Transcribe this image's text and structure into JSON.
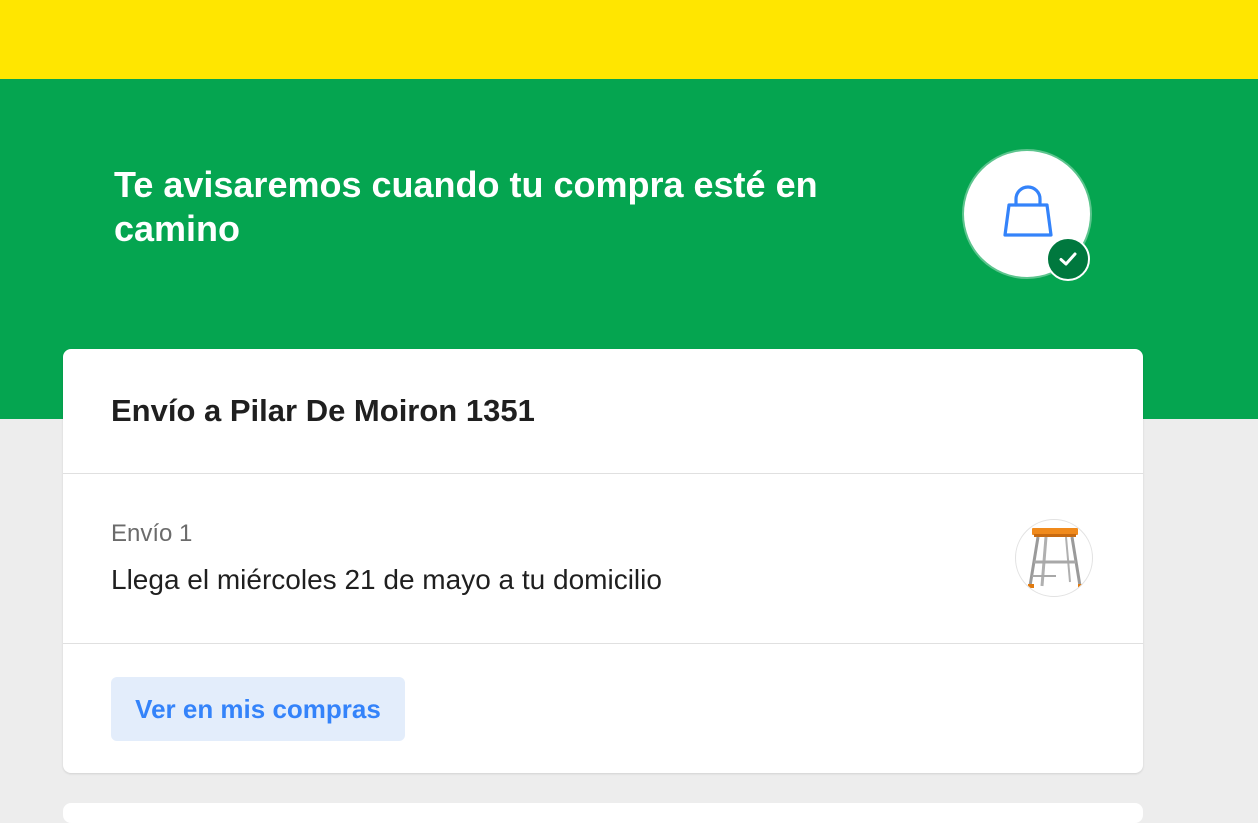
{
  "hero": {
    "title": "Te avisaremos cuando tu compra esté en camino",
    "icon": "shopping-bag-icon",
    "status_icon": "check-circle-icon"
  },
  "card": {
    "title": "Envío a Pilar De Moiron 1351",
    "shipment": {
      "label": "Envío 1",
      "eta": "Llega el miércoles 21 de mayo a tu domicilio",
      "product_image": "step-ladder-thumbnail"
    },
    "button_label": "Ver en mis compras"
  },
  "colors": {
    "topbar": "#ffe600",
    "hero": "#05a550",
    "accent": "#3483fa",
    "check": "#00783e"
  }
}
